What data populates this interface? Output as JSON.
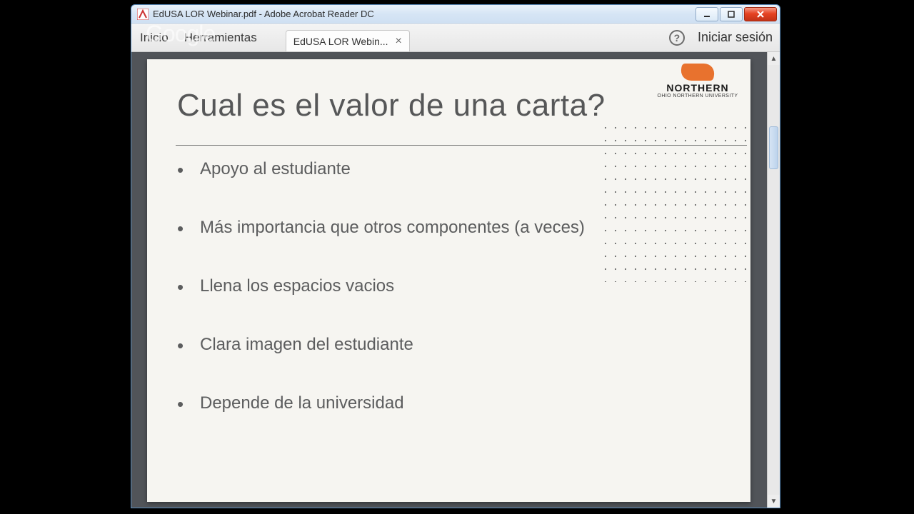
{
  "window": {
    "title": "EdUSA LOR Webinar.pdf - Adobe Acrobat Reader DC"
  },
  "toolbar": {
    "inicio": "Inicio",
    "herramientas": "Herramientas",
    "tab_label": "EdUSA LOR Webin...",
    "signin": "Iniciar sesión",
    "help_glyph": "?"
  },
  "slide": {
    "title": "Cual es el valor de una carta?",
    "bullets": [
      "Apoyo al estudiante",
      "Más importancia que otros componentes (a veces)",
      "Llena los espacios vacios",
      "Clara imagen del estudiante",
      "Depende de la universidad"
    ],
    "logo_big": "NORTHERN",
    "logo_sub": "OHIO NORTHERN UNIVERSITY"
  },
  "watermark": "Google"
}
